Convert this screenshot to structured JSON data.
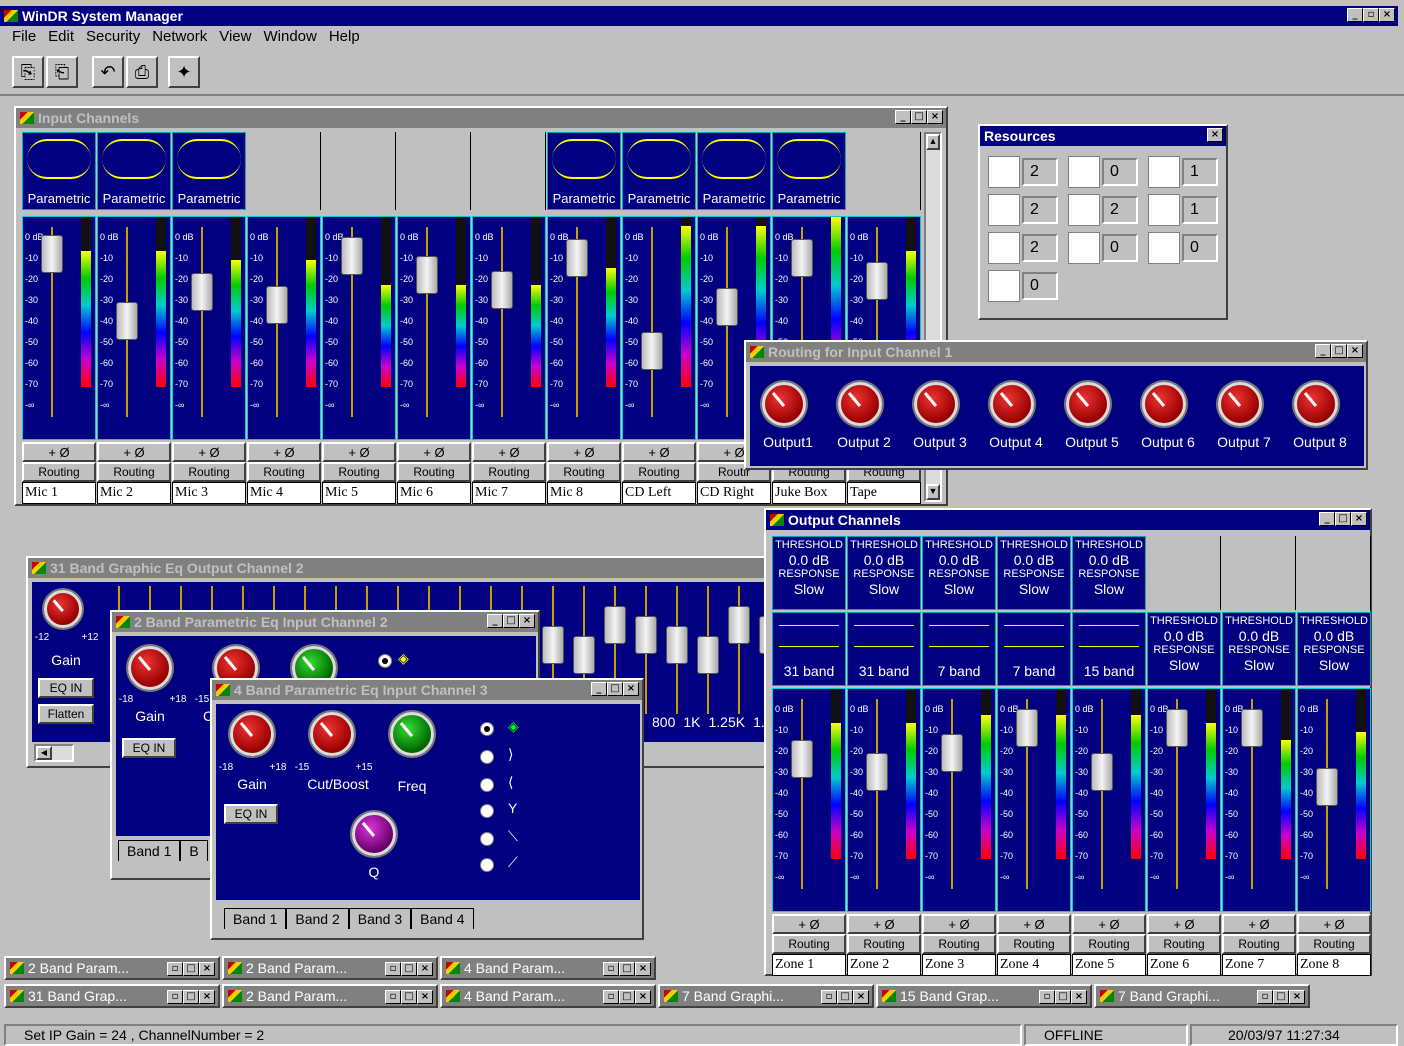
{
  "app": {
    "title": "WinDR System Manager"
  },
  "menu": [
    "File",
    "Edit",
    "Security",
    "Network",
    "View",
    "Window",
    "Help"
  ],
  "toolbar": [
    "copy-icon",
    "paste-icon",
    "undo-icon",
    "print-icon",
    "wizard-icon"
  ],
  "input_channels": {
    "title": "Input Channels",
    "eq_label": "Parametric",
    "phase_label": "+ Ø",
    "routing_label": "Routing",
    "routing_short": "Routir",
    "scale": [
      "0 dB",
      "-10",
      "-20",
      "-30",
      "-40",
      "-50",
      "-60",
      "-70",
      "-∞"
    ],
    "channels": [
      "Mic 1",
      "Mic 2",
      "Mic 3",
      "Mic 4",
      "Mic 5",
      "Mic 6",
      "Mic 7",
      "Mic 8",
      "CD Left",
      "CD Right",
      "Juke Box",
      "Tape"
    ],
    "fader_levels": [
      0.06,
      0.45,
      0.28,
      0.36,
      0.07,
      0.18,
      0.27,
      0.08,
      0.63,
      0.37,
      0.08,
      0.22
    ],
    "meter_levels": [
      0.8,
      0.8,
      0.75,
      0.75,
      0.6,
      0.6,
      0.6,
      0.7,
      0.95,
      0.95,
      1.0,
      0.8
    ]
  },
  "resources": {
    "title": "Resources",
    "items": [
      {
        "icon": "crossover-2-icon",
        "count": "2"
      },
      {
        "icon": "crossover-disabled-icon",
        "count": "0"
      },
      {
        "icon": "crossover-4-icon",
        "count": "1"
      },
      {
        "icon": "crossover-6-icon",
        "count": "2"
      },
      {
        "icon": "graphic-eq-7-icon",
        "count": "2"
      },
      {
        "icon": "graphic-eq-15-icon",
        "count": "1"
      },
      {
        "icon": "graphic-eq-31-icon",
        "count": "2"
      },
      {
        "icon": "delay-icon",
        "count": "0"
      },
      {
        "icon": "filter-icon",
        "count": "0"
      },
      {
        "icon": "notch-icon",
        "count": "0"
      }
    ]
  },
  "routing": {
    "title": "Routing for Input Channel 1",
    "outputs": [
      "Output1",
      "Output 2",
      "Output 3",
      "Output 4",
      "Output 5",
      "Output 6",
      "Output 7",
      "Output 8"
    ]
  },
  "output_channels": {
    "title": "Output Channels",
    "threshold_label": "THRESHOLD",
    "threshold_value": "0.0 dB",
    "response_label": "RESPONSE",
    "response_value": "Slow",
    "bands": [
      "31 band",
      "31 band",
      "7 band",
      "7 band",
      "15 band"
    ],
    "zones": [
      "Zone 1",
      "Zone 2",
      "Zone 3",
      "Zone 4",
      "Zone 5",
      "Zone 6",
      "Zone 7",
      "Zone 8"
    ],
    "phase_label": "+ Ø",
    "routing_label": "Routing",
    "scale": [
      "0 dB",
      "-10",
      "-20",
      "-30",
      "-40",
      "-50",
      "-60",
      "-70",
      "-∞"
    ],
    "fader_levels": [
      0.25,
      0.33,
      0.22,
      0.07,
      0.33,
      0.07,
      0.07,
      0.42
    ],
    "meter_levels": [
      0.8,
      0.8,
      0.85,
      0.85,
      0.85,
      0.8,
      0.7,
      0.75
    ]
  },
  "graphic_eq31": {
    "title": "31 Band Graphic Eq Output Channel 2",
    "gain_label": "Gain",
    "min": "-12",
    "max": "+12",
    "eq_in": "EQ IN",
    "flatten": "Flatten",
    "freqs": [
      "800",
      "1K",
      "1.25K",
      "1."
    ]
  },
  "param2": {
    "title": "2 Band Parametric Eq Input Channel 2",
    "gain_label": "Gain",
    "min": "-18",
    "max": "+18",
    "min2": "-15",
    "cut_short": "C",
    "eq_in": "EQ IN",
    "tabs": [
      "Band 1",
      "B"
    ]
  },
  "param4": {
    "title": "4 Band Parametric Eq Input Channel 3",
    "gain_label": "Gain",
    "cut_label": "Cut/Boost",
    "freq_label": "Freq",
    "q_label": "Q",
    "gain_min": "-18",
    "gain_max": "+18",
    "cut_min": "-15",
    "cut_max": "+15",
    "eq_in": "EQ IN",
    "tabs": [
      "Band 1",
      "Band 2",
      "Band 3",
      "Band 4"
    ]
  },
  "taskbar": {
    "row1": [
      "2 Band Param...",
      "2 Band Param...",
      "4 Band Param..."
    ],
    "row2": [
      "31 Band Grap...",
      "2 Band Param...",
      "4 Band Param...",
      "7 Band Graphi...",
      "15 Band Grap...",
      "7 Band Graphi..."
    ]
  },
  "status": {
    "message": "Set IP Gain = 24 , ChannelNumber = 2",
    "mode": "OFFLINE",
    "datetime": "20/03/97 11:27:34"
  },
  "colors": {
    "panel": "#000080",
    "titlebar": "#000080",
    "inactive": "#808080"
  }
}
